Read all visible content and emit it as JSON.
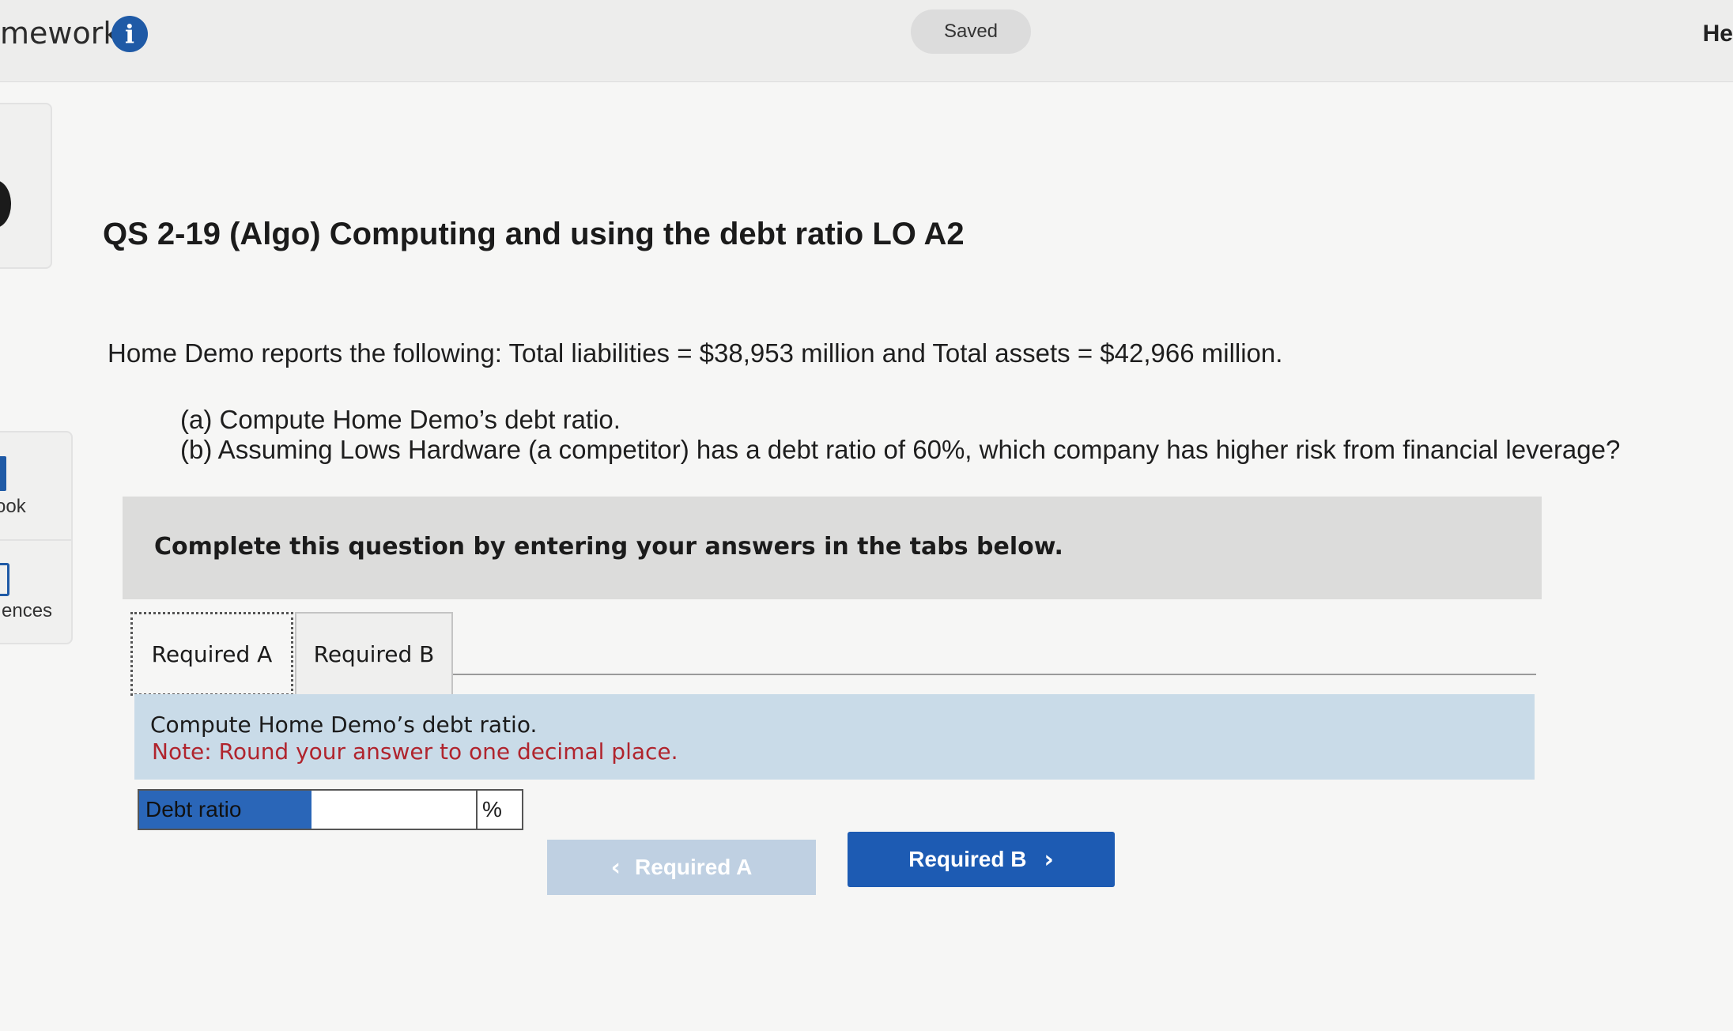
{
  "header": {
    "app_title": "mework",
    "info_icon": "info-icon",
    "saved_label": "Saved",
    "help_label": "He"
  },
  "sidebar": {
    "ebook_label": "ook",
    "references_label": "ences"
  },
  "question": {
    "title": "QS 2-19 (Algo) Computing and using the debt ratio LO A2",
    "text": "Home Demo reports the following: Total liabilities = $38,953 million and Total assets = $42,966 million.",
    "part_a": "(a) Compute Home Demo’s debt ratio.",
    "part_b": "(b) Assuming Lows Hardware (a competitor) has a debt ratio of 60%, which company has higher risk from financial leverage?"
  },
  "instructions": "Complete this question by entering your answers in the tabs below.",
  "tabs": [
    {
      "label": "Required A",
      "active": true
    },
    {
      "label": "Required B",
      "active": false
    }
  ],
  "panel": {
    "prompt": "Compute Home Demo’s debt ratio.",
    "note": "Note: Round your answer to one decimal place."
  },
  "answer": {
    "label": "Debt ratio",
    "value": "",
    "unit": "%"
  },
  "nav": {
    "prev_label": "Required A",
    "prev_icon": "chevron-left-icon",
    "next_label": "Required B",
    "next_icon": "chevron-right-icon"
  },
  "colors": {
    "accent": "#1d5bb3",
    "panel_bg": "#c9dbe8",
    "note_red": "#b0242d"
  }
}
